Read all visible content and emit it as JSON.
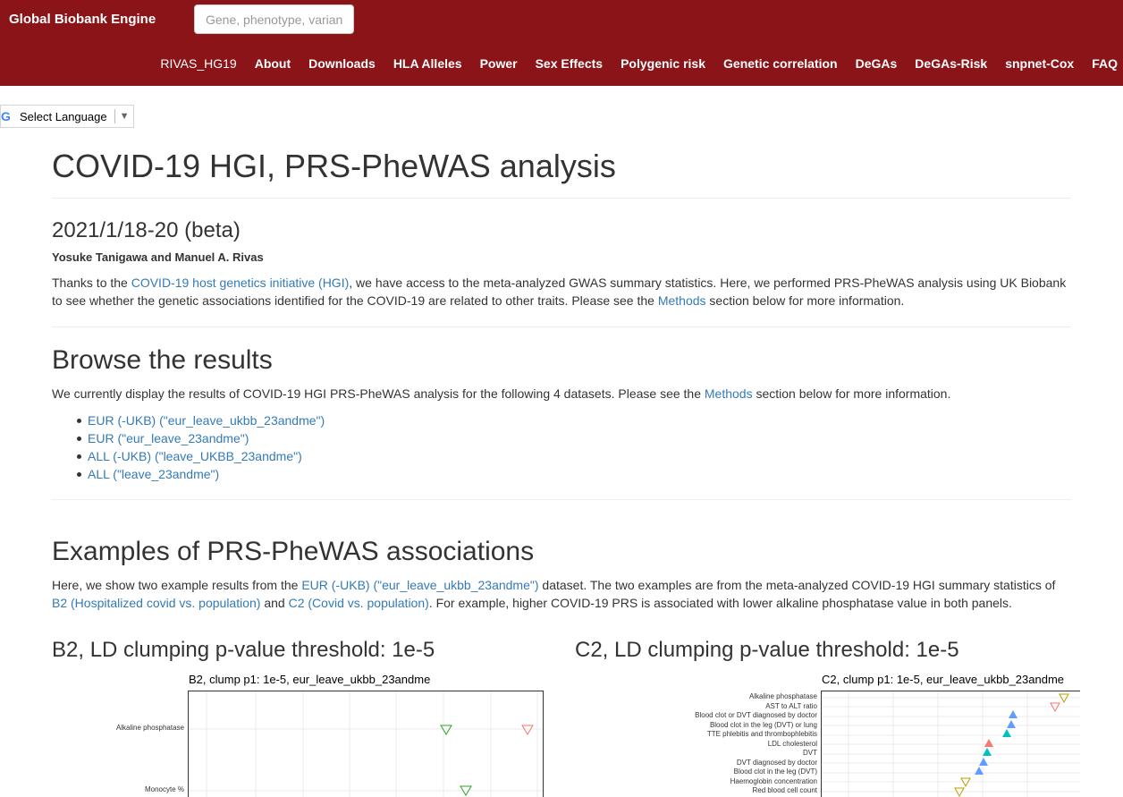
{
  "header": {
    "brand": "Global Biobank Engine",
    "search_placeholder": "Gene, phenotype, varian",
    "nav": [
      "RIVAS_HG19",
      "About",
      "Downloads",
      "HLA Alleles",
      "Power",
      "Sex Effects",
      "Polygenic risk",
      "Genetic correlation",
      "DeGAs",
      "DeGAs-Risk",
      "snpnet-Cox",
      "FAQ"
    ]
  },
  "language": {
    "label": "Select Language",
    "icon": "google-g-icon",
    "arrow": "▼"
  },
  "page": {
    "title": "COVID-19 HGI, PRS-PheWAS analysis",
    "date": "2021/1/18-20 (beta)",
    "authors": "Yosuke Tanigawa and Manuel A. Rivas",
    "intro": {
      "p1": "Thanks to the ",
      "link_hgi": "COVID-19 host genetics initiative (HGI)",
      "p2": ", we have access to the meta-analyzed GWAS summary statistics. Here, we performed PRS-PheWAS analysis using UK Biobank to see whether the genetic associations identified for the COVID-19 are related to other traits. Please see the ",
      "link_methods": "Methods",
      "p3": " section below for more information."
    },
    "browse": {
      "heading": "Browse the results",
      "p1": "We currently display the results of COVID-19 HGI PRS-PheWAS analysis for the following 4 datasets. Please see the ",
      "link_methods": "Methods",
      "p2": " section below for more information.",
      "datasets": [
        "EUR (-UKB) (\"eur_leave_ukbb_23andme\")",
        "EUR (\"eur_leave_23andme\")",
        "ALL (-UKB) (\"leave_UKBB_23andme\")",
        "ALL (\"leave_23andme\")"
      ]
    },
    "examples": {
      "heading": "Examples of PRS-PheWAS associations",
      "p1": "Here, we show two example results from the ",
      "link_dataset": "EUR (-UKB) (\"eur_leave_ukbb_23andme\")",
      "p2": " dataset. The two examples are from the meta-analyzed COVID-19 HGI summary statistics of ",
      "link_b2": "B2 (Hospitalized covid vs. population)",
      "p3": " and ",
      "link_c2": "C2 (Covid vs. population)",
      "p4": ". For example, higher COVID-19 PRS is associated with lower alkaline phosphatase value in both panels."
    },
    "panels": [
      {
        "heading": "B2, LD clumping p-value threshold: 1e-5",
        "plot_title": "B2, clump p1: 1e-5, eur_leave_ukbb_23andme",
        "rows": [
          "Alkaline phosphatase",
          "Monocyte %"
        ]
      },
      {
        "heading": "C2, LD clumping p-value threshold: 1e-5",
        "plot_title": "C2, clump p1: 1e-5, eur_leave_ukbb_23andme",
        "rows": [
          "Alkaline phosphatase",
          "AST to ALT ratio",
          "Blood clot or DVT diagnosed by doctor",
          "Blood clot in the leg (DVT) or lung",
          "TTE phlebitis and thrombophlebitis",
          "LDL cholesterol",
          "DVT",
          "DVT diagnosed by doctor",
          "Blood clot in the leg (DVT)",
          "Haemoglobin concentration",
          "Red blood cell count"
        ]
      }
    ]
  },
  "colors": {
    "navbar": "#8b1418",
    "link": "#337ab7",
    "green": "#2ca02c",
    "red": "#f8766d",
    "blue": "#619cff",
    "teal": "#00bfc4",
    "olive": "#b79f00"
  }
}
